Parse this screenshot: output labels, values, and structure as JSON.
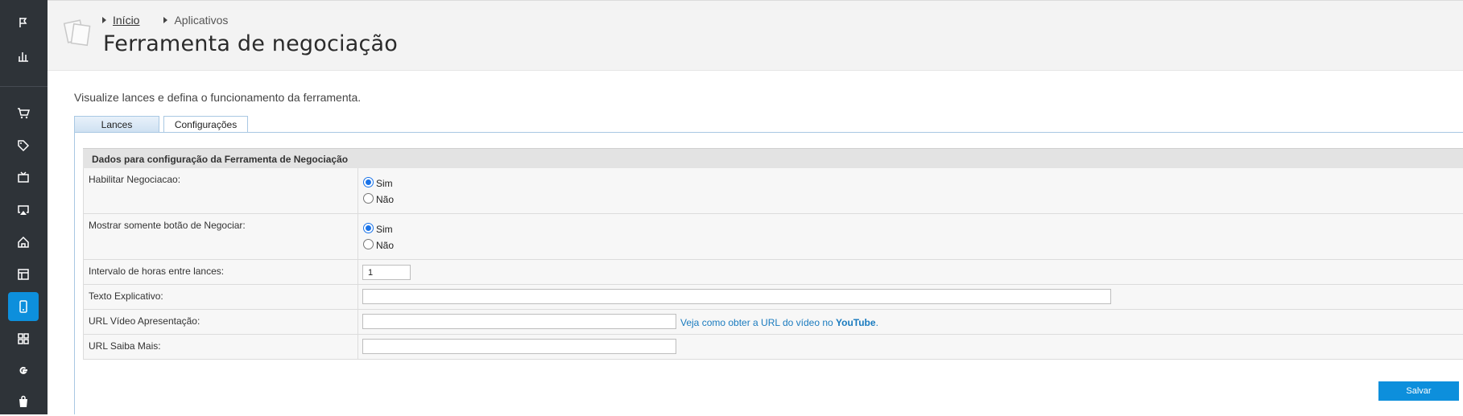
{
  "sidebar": {
    "icons": [
      "flag-icon",
      "bar-chart-icon",
      "cart-icon",
      "tag-icon",
      "tv-icon",
      "airplay-icon",
      "home-icon",
      "layout-icon",
      "smartphone-icon",
      "grid-icon",
      "google-icon",
      "bag-icon"
    ],
    "active": "smartphone-icon"
  },
  "breadcrumb": {
    "home": "Início",
    "current": "Aplicativos"
  },
  "page": {
    "title": "Ferramenta de negociação",
    "description": "Visualize lances e defina o funcionamento da ferramenta."
  },
  "tabs": [
    {
      "label": "Lances"
    },
    {
      "label": "Configurações"
    }
  ],
  "active_tab": "Configurações",
  "section": {
    "title": "Dados para configuração da Ferramenta de Negociação"
  },
  "form": {
    "habilitar": {
      "label": "Habilitar Negociacao:",
      "opt_yes": "Sim",
      "opt_no": "Não",
      "selected": "Sim"
    },
    "mostrar": {
      "label": "Mostrar somente botão de Negociar:",
      "opt_yes": "Sim",
      "opt_no": "Não",
      "selected": "Sim"
    },
    "intervalo": {
      "label": "Intervalo de horas entre lances:",
      "value": "1"
    },
    "texto": {
      "label": "Texto Explicativo:",
      "value": ""
    },
    "url_video": {
      "label": "URL Vídeo Apresentação:",
      "value": "",
      "help_prefix": "Veja como obter a URL do vídeo no ",
      "help_brand": "YouTube",
      "help_suffix": "."
    },
    "url_saiba": {
      "label": "URL Saiba Mais:",
      "value": ""
    }
  },
  "actions": {
    "save": "Salvar"
  },
  "colors": {
    "sidebar": "#2e3338",
    "accent": "#0d8fdc",
    "link": "#1a7bbf"
  }
}
